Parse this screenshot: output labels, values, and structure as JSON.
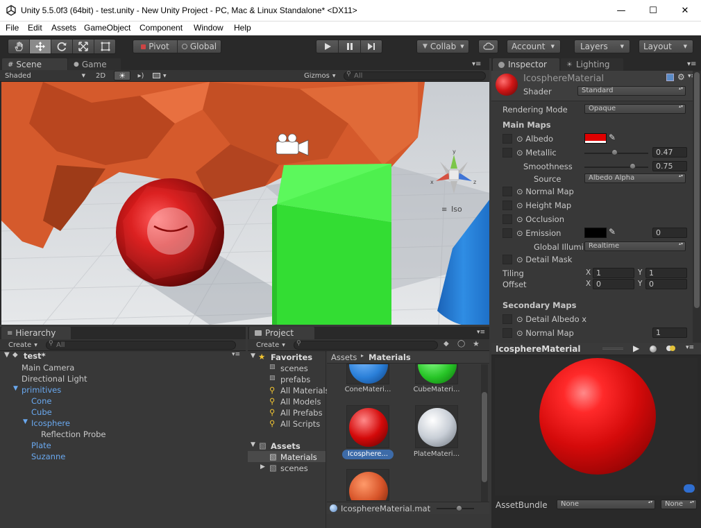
{
  "window": {
    "title": "Unity 5.5.0f3 (64bit) - test.unity - New Unity Project - PC, Mac & Linux Standalone* <DX11>",
    "controls": {
      "minimize": "—",
      "maximize": "☐",
      "close": "✕"
    }
  },
  "menu": [
    "File",
    "Edit",
    "Assets",
    "GameObject",
    "Component",
    "Window",
    "Help"
  ],
  "toolbar": {
    "pivot": "Pivot",
    "global": "Global",
    "collab": "Collab",
    "account": "Account",
    "layers": "Layers",
    "layout": "Layout"
  },
  "scene": {
    "tab_scene": "Scene",
    "tab_game": "Game",
    "shading": "Shaded",
    "mode_2d": "2D",
    "gizmos": "Gizmos",
    "search_placeholder": "All",
    "gizmo_y": "y",
    "gizmo_x": "x",
    "gizmo_z": "z",
    "iso": "Iso",
    "colors": {
      "sky": "#d8dde2",
      "ground": "#e4e6e8",
      "red_sphere": "#d41a1a",
      "green_cube": "#33dd33",
      "blue_cone": "#2f8de4",
      "orange_suzanne": "#d55a2c"
    }
  },
  "inspector": {
    "tab_inspector": "Inspector",
    "tab_lighting": "Lighting",
    "material_name": "IcosphereMaterial",
    "shader_label": "Shader",
    "shader_value": "Standard",
    "rendering_mode_label": "Rendering Mode",
    "rendering_mode_value": "Opaque",
    "main_maps": "Main Maps",
    "albedo": "Albedo",
    "albedo_color": "#e00000",
    "metallic": "Metallic",
    "metallic_value": "0.47",
    "metallic_fraction": 0.47,
    "smoothness": "Smoothness",
    "smoothness_value": "0.75",
    "smoothness_fraction": 0.75,
    "source_label": "Source",
    "source_value": "Albedo Alpha",
    "normal_map": "Normal Map",
    "height_map": "Height Map",
    "occlusion": "Occlusion",
    "emission": "Emission",
    "emission_value": "0",
    "global_illum": "Global Illumi",
    "global_illum_value": "Realtime",
    "detail_mask": "Detail Mask",
    "tiling": "Tiling",
    "offset": "Offset",
    "x_label": "X",
    "y_label": "Y",
    "tiling_x": "1",
    "tiling_y": "1",
    "offset_x": "0",
    "offset_y": "0",
    "secondary_maps": "Secondary Maps",
    "detail_albedo": "Detail Albedo x",
    "normal_map2": "Normal Map",
    "normal_map2_value": "1"
  },
  "preview": {
    "title": "IcosphereMaterial",
    "asset_bundle_label": "AssetBundle",
    "asset_bundle_value": "None",
    "variant_value": "None"
  },
  "hierarchy": {
    "tab": "Hierarchy",
    "create": "Create",
    "search_placeholder": "All",
    "scene_name": "test*",
    "items": [
      {
        "label": "Main Camera",
        "indent": 1
      },
      {
        "label": "Directional Light",
        "indent": 1
      },
      {
        "label": "primitives",
        "indent": 1
      },
      {
        "label": "Cone",
        "indent": 2
      },
      {
        "label": "Cube",
        "indent": 2
      },
      {
        "label": "Icosphere",
        "indent": 2
      },
      {
        "label": "Reflection Probe",
        "indent": 3
      },
      {
        "label": "Plate",
        "indent": 2
      },
      {
        "label": "Suzanne",
        "indent": 2
      }
    ]
  },
  "project": {
    "tab": "Project",
    "create": "Create",
    "favorites": "Favorites",
    "fav_items": [
      "scenes",
      "prefabs",
      "All Materials",
      "All Models",
      "All Prefabs",
      "All Scripts"
    ],
    "assets": "Assets",
    "asset_folders": [
      "Materials",
      "scenes"
    ],
    "breadcrumb_root": "Assets",
    "breadcrumb_sep": "▸",
    "breadcrumb_current": "Materials",
    "thumbs": [
      "ConeMateri...",
      "CubeMateri...",
      "Icosphere...",
      "PlateMateri..."
    ],
    "selected_file": "IcosphereMaterial.mat"
  }
}
